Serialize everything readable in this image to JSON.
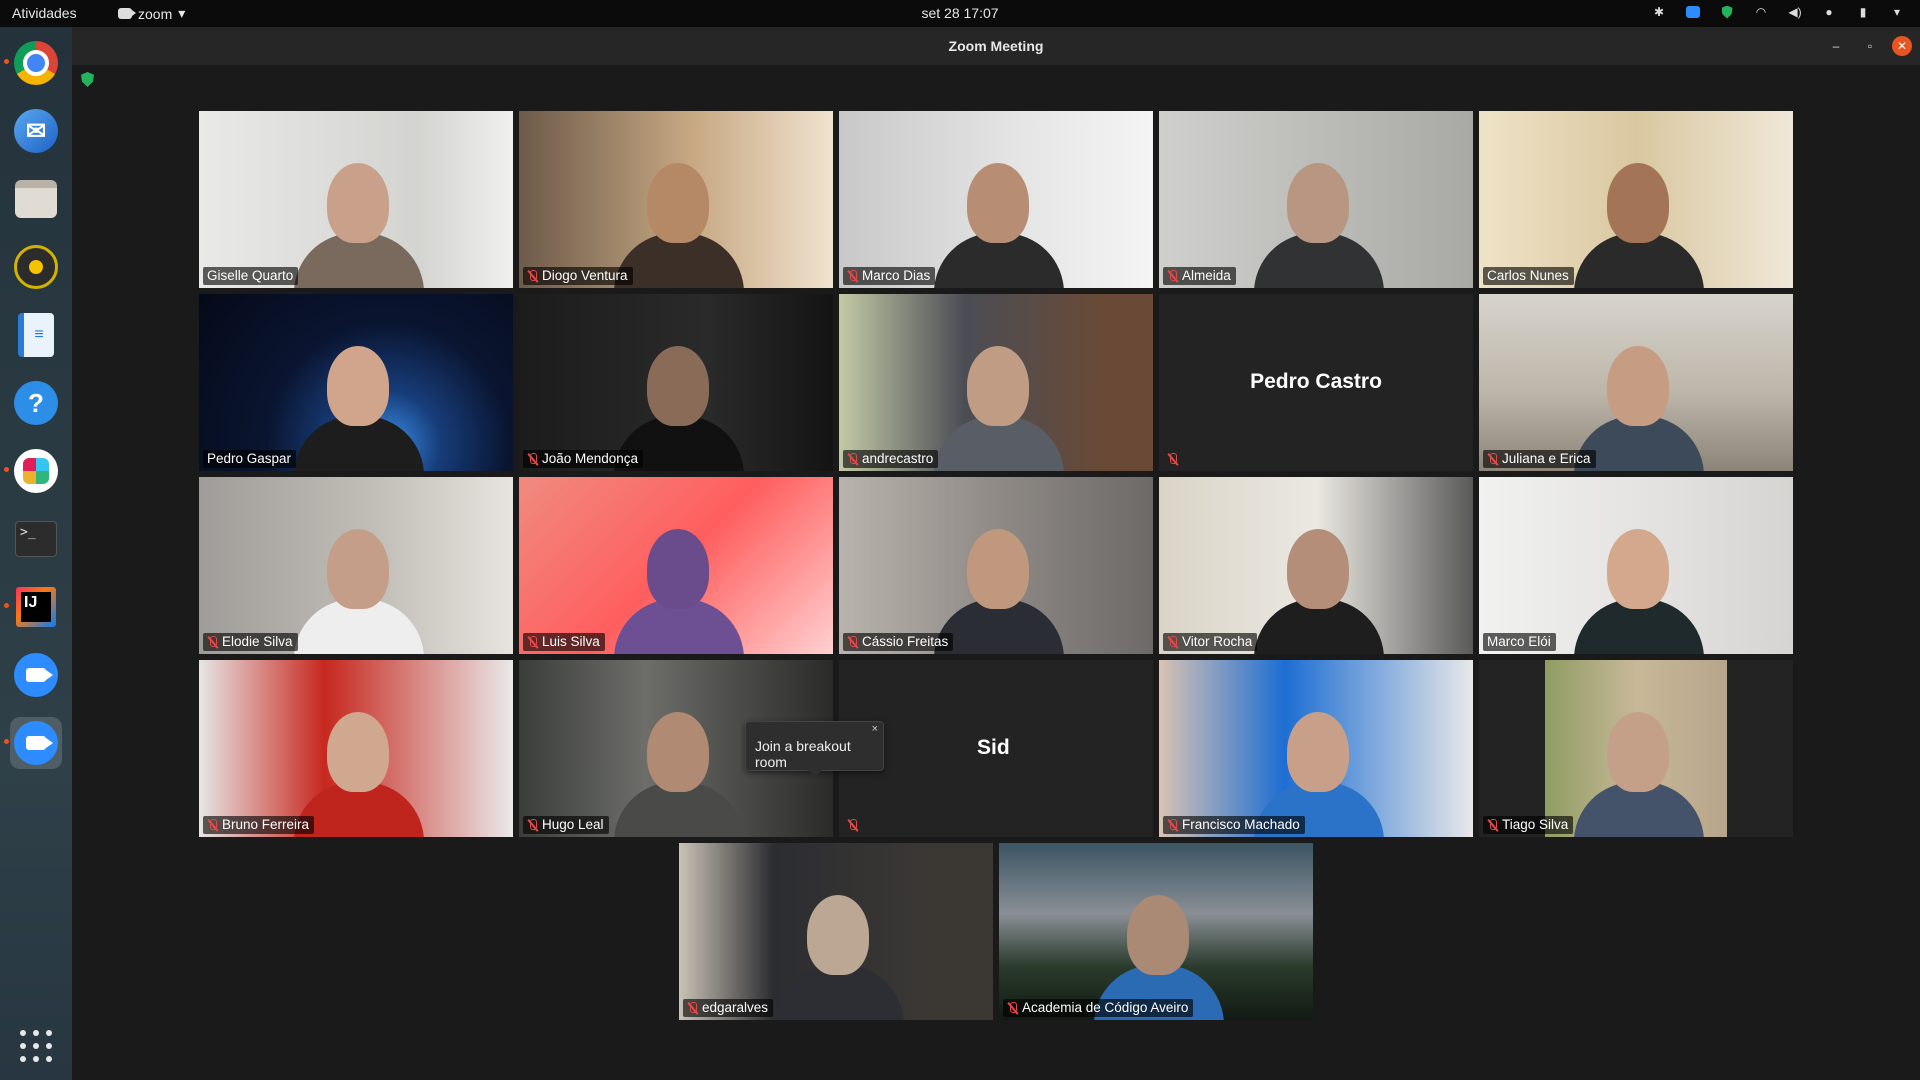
{
  "topbar": {
    "activities": "Atividades",
    "app_name": "zoom",
    "clock": "set 28  17:07"
  },
  "window": {
    "title": "Zoom Meeting"
  },
  "participants": [
    {
      "name": "Giselle Quarto",
      "muted": false
    },
    {
      "name": "Diogo Ventura",
      "muted": true
    },
    {
      "name": "Marco Dias",
      "muted": true
    },
    {
      "name": "Almeida",
      "muted": true
    },
    {
      "name": "Carlos Nunes",
      "muted": false
    },
    {
      "name": "Pedro Gaspar",
      "muted": false,
      "speaking": true
    },
    {
      "name": "João Mendonça",
      "muted": true
    },
    {
      "name": "andrecastro",
      "muted": true
    },
    {
      "name": "Pedro Castro",
      "muted": true,
      "video_off": true
    },
    {
      "name": "Juliana e Erica",
      "muted": true
    },
    {
      "name": "Elodie Silva",
      "muted": true
    },
    {
      "name": "Luis Silva",
      "muted": true
    },
    {
      "name": "Cássio Freitas",
      "muted": true
    },
    {
      "name": "Vitor Rocha",
      "muted": true
    },
    {
      "name": "Marco Elói",
      "muted": false
    },
    {
      "name": "Bruno Ferreira",
      "muted": true
    },
    {
      "name": "Hugo Leal",
      "muted": true
    },
    {
      "name": "Sid",
      "muted": true,
      "video_off": true
    },
    {
      "name": "Francisco Machado",
      "muted": true
    },
    {
      "name": "Tiago Silva",
      "muted": true
    },
    {
      "name": "edgaralves",
      "muted": true
    },
    {
      "name": "Academia de Código Aveiro",
      "muted": true
    }
  ],
  "tooltip": {
    "text": "Join a breakout room",
    "close": "×",
    "partial_name_visible": "Sid"
  },
  "dock": [
    "chrome-icon",
    "thunderbird-icon",
    "files-icon",
    "rhythmbox-icon",
    "writer-icon",
    "help-icon",
    "slack-icon",
    "terminal-icon",
    "intellij-icon",
    "zoom-icon",
    "zoom-icon"
  ]
}
